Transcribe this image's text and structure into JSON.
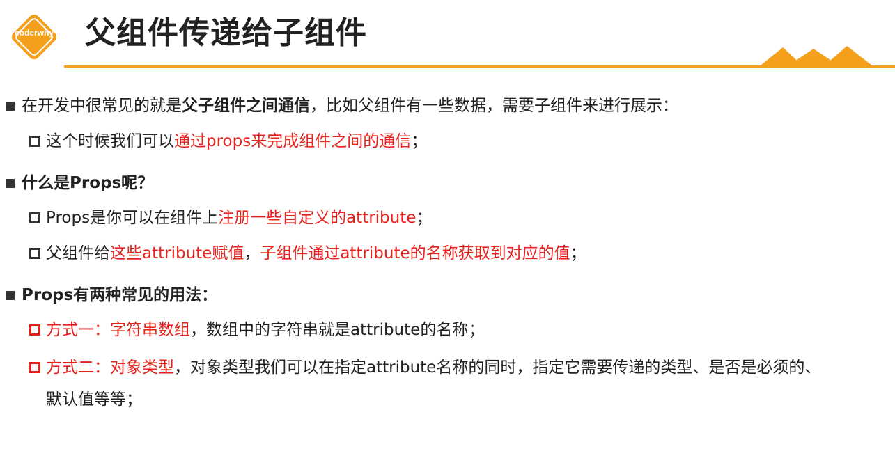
{
  "header": {
    "logo_text": "coderwhy",
    "title": "父组件传递给子组件",
    "accent_color": "#f4a01c"
  },
  "content": {
    "p1": {
      "pre": "在开发中很常见的就是",
      "bold": "父子组件之间通信",
      "post": "，比如父组件有一些数据，需要子组件来进行展示："
    },
    "p1_sub": {
      "pre": "这个时候我们可以",
      "red": "通过props来完成组件之间的通信",
      "post": "；"
    },
    "p2": {
      "bold": "什么是Props呢？"
    },
    "p2_sub1": {
      "pre": "Props是你可以在组件上",
      "red": "注册一些自定义的attribute",
      "post": "；"
    },
    "p2_sub2": {
      "pre": "父组件给",
      "red1": "这些attribute赋值",
      "mid": "，",
      "red2": "子组件通过attribute的名称获取到对应的值",
      "post": "；"
    },
    "p3": {
      "bold": "Props有两种常见的用法："
    },
    "p3_sub1": {
      "red": "方式一：字符串数组",
      "post": "，数组中的字符串就是attribute的名称；"
    },
    "p3_sub2": {
      "red": "方式二：对象类型",
      "post": "，对象类型我们可以在指定attribute名称的同时，指定它需要传递的类型、是否是必须的、",
      "cont": "默认值等等；"
    },
    "highlight_color": "#e8211c"
  }
}
